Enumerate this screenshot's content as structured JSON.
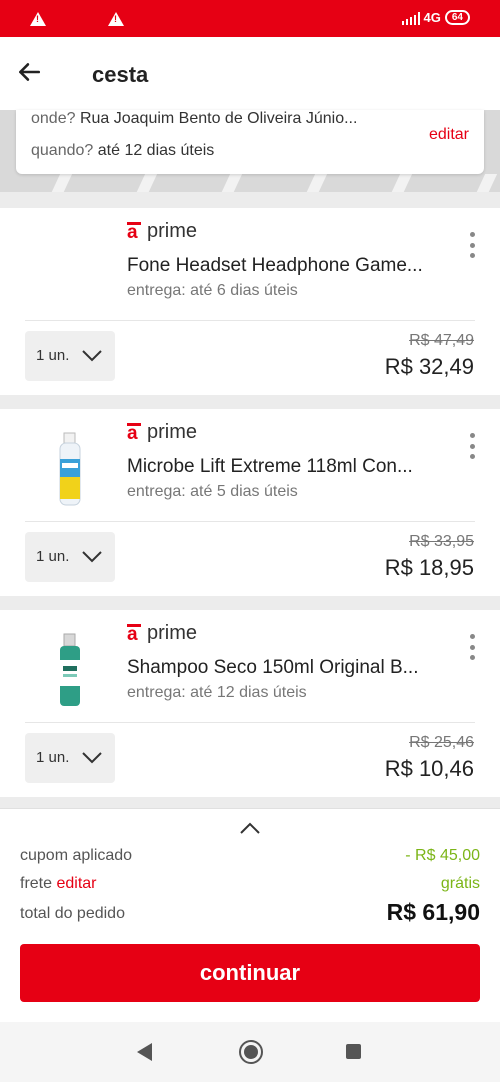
{
  "status_bar": {
    "network": "4G",
    "battery": "64"
  },
  "header": {
    "title": "cesta"
  },
  "delivery": {
    "where_label": "onde?",
    "where_value": "Rua Joaquim Bento de Oliveira Júnio...",
    "when_label": "quando?",
    "when_value": "até 12 dias úteis",
    "edit_label": "editar"
  },
  "products": [
    {
      "badge": "prime",
      "name": "Fone Headset Headphone Game...",
      "delivery": "entrega: até 6 dias úteis",
      "qty": "1 un.",
      "old_price": "R$ 47,49",
      "price": "R$ 32,49"
    },
    {
      "badge": "prime",
      "name": "Microbe Lift Extreme 118ml Con...",
      "delivery": "entrega: até 5 dias úteis",
      "qty": "1 un.",
      "old_price": "R$ 33,95",
      "price": "R$ 18,95"
    },
    {
      "badge": "prime",
      "name": "Shampoo Seco 150ml Original B...",
      "delivery": "entrega: até 12 dias úteis",
      "qty": "1 un.",
      "old_price": "R$ 25,46",
      "price": "R$ 10,46"
    }
  ],
  "summary": {
    "coupon_label": "cupom aplicado",
    "coupon_value": "- R$ 45,00",
    "shipping_label": "frete",
    "shipping_edit": "editar",
    "shipping_value": "grátis",
    "total_label": "total do pedido",
    "total_value": "R$ 61,90",
    "continue_label": "continuar"
  },
  "colors": {
    "brand": "#e60014",
    "success": "#7cb518"
  }
}
